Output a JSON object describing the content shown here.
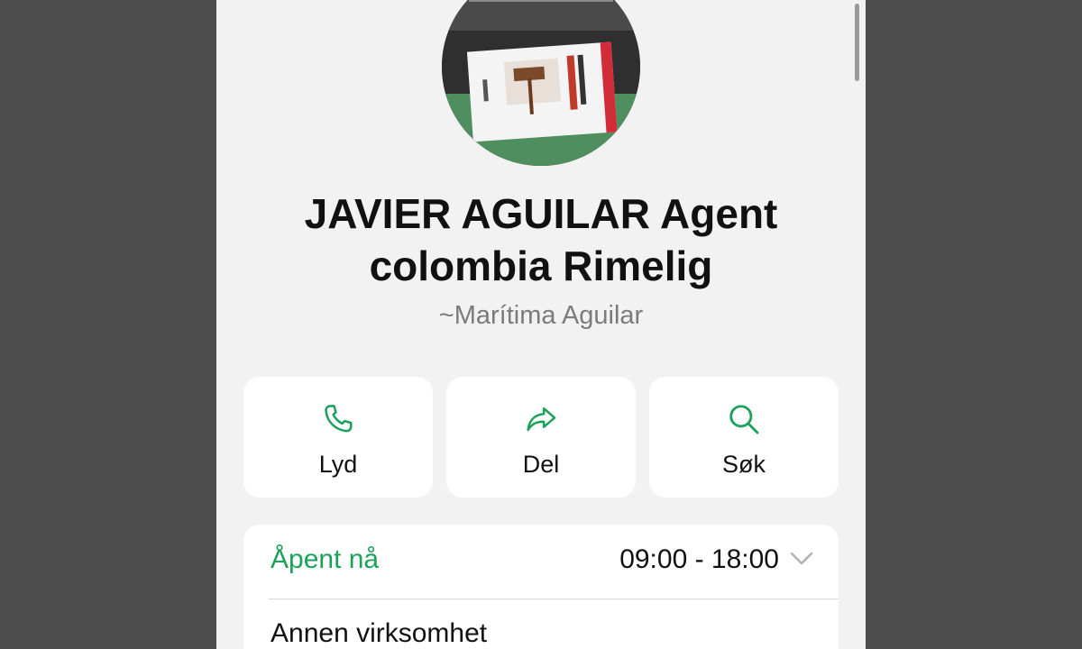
{
  "profile": {
    "name": "JAVIER AGUILAR Agent colombia Rimelig",
    "subtitle": "~Marítima Aguilar"
  },
  "actions": [
    {
      "label": "Lyd",
      "icon": "phone-icon"
    },
    {
      "label": "Del",
      "icon": "share-icon"
    },
    {
      "label": "Søk",
      "icon": "search-icon"
    }
  ],
  "info": {
    "status_label": "Åpent nå",
    "hours": "09:00 - 18:00",
    "category": "Annen virksomhet"
  },
  "colors": {
    "accent": "#1da15a",
    "background": "#f2f2f2",
    "backdrop": "#4d4d4d"
  }
}
